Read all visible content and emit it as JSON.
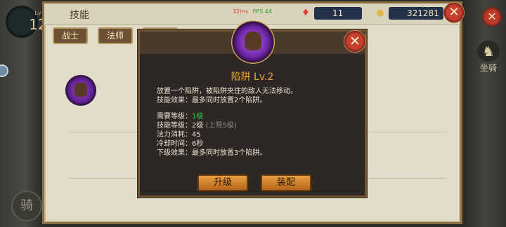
{
  "player": {
    "level_caption": "Lv",
    "level": "12"
  },
  "hud": {
    "ride_label": "骑",
    "mount_label": "坐骑"
  },
  "panel": {
    "title": "技能",
    "ping": "32ms",
    "fps": "FPS 44",
    "gems": "11",
    "gold": "321281",
    "tabs": [
      "战士",
      "法师",
      ""
    ]
  },
  "skill_modal": {
    "name": "陷阱 Lv.2",
    "desc_line1": "放置一个陷阱，被陷阱夹住的敌人无法移动。",
    "desc_line2": "技能效果：最多同时放置2个陷阱。",
    "req_level_label": "需要等级：",
    "req_level_value": "1级",
    "skill_level_label": "技能等级：",
    "skill_level_value": "2级",
    "skill_level_cap": "(上限5级)",
    "mana_cost": "法力消耗：45",
    "cooldown": "冷却时间：6秒",
    "next_effect": "下级效果：最多同时放置3个陷阱。",
    "upgrade_label": "升级",
    "equip_label": "装配"
  },
  "colors": {
    "skill_name": "#f2a22a",
    "req_ok": "#2fd23c",
    "button": "#e6a041"
  }
}
